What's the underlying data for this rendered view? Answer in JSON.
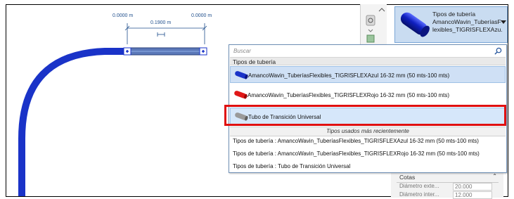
{
  "dimensions": {
    "left": "0.0000 m",
    "center": "0.1900 m",
    "right": "0.0000 m"
  },
  "type_selector": {
    "line1": "Tipos de tubería",
    "line2": "AmancoWavin_TuberíasF",
    "line3": "lexibles_TIGRISFLEXAzu..."
  },
  "dropdown": {
    "search_placeholder": "Buscar",
    "category": "Tipos de tubería",
    "items": [
      {
        "label": "AmancoWavin_TuberíasFlexibles_TIGRISFLEXAzul 16-32 mm (50 mts-100 mts)",
        "color": "#1a33c8",
        "state": "selected"
      },
      {
        "label": "AmancoWavin_TuberíasFlexibles_TIGRISFLEXRojo 16-32 mm (50 mts-100 mts)",
        "color": "#e01818",
        "state": "normal"
      },
      {
        "label": "Tubo de Transición Universal",
        "color": "#9a9a9a",
        "state": "highlighted"
      }
    ],
    "recent_header": "Tipos usados más recientemente",
    "recent": [
      "Tipos de tubería : AmancoWavin_TuberíasFlexibles_TIGRISFLEXAzul 16-32 mm (50 mts-100 mts)",
      "Tipos de tubería : AmancoWavin_TuberíasFlexibles_TIGRISFLEXRojo 16-32 mm (50 mts-100 mts)",
      "Tipos de tubería : Tubo de Transición Universal"
    ]
  },
  "properties": {
    "section": "Cotas",
    "rows": [
      {
        "label": "Diámetro exte...",
        "value": "20.000"
      },
      {
        "label": "Diámetro inter...",
        "value": "12.000"
      }
    ]
  },
  "colors": {
    "pipe_blue": "#1a33c8",
    "selection": "#cfe0f5",
    "highlight_box": "#e01010"
  }
}
